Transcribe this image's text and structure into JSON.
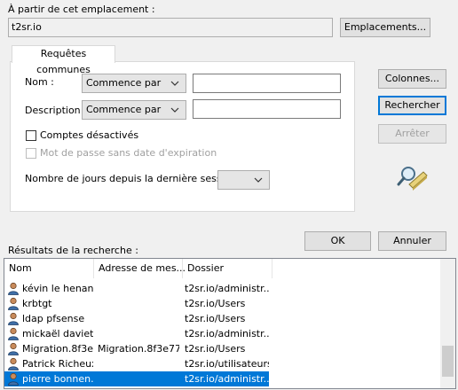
{
  "location": {
    "label": "À partir de cet emplacement :",
    "value": "t2sr.io",
    "button": "Emplacements..."
  },
  "tab": {
    "label": "Requêtes communes"
  },
  "query": {
    "name_label": "Nom :",
    "name_op": "Commence par",
    "name_value": "",
    "desc_label": "Description :",
    "desc_op": "Commence par",
    "desc_value": "",
    "disabled_accounts": "Comptes désactivés",
    "no_expire_pw": "Mot de passe sans date d'expiration",
    "days_label": "Nombre de jours depuis la dernière session :",
    "days_value": ""
  },
  "buttons": {
    "columns": "Colonnes...",
    "search": "Rechercher",
    "stop": "Arrêter",
    "ok": "OK",
    "cancel": "Annuler"
  },
  "results": {
    "label": "Résultats de la recherche :",
    "columns": [
      "Nom",
      "Adresse de mes...",
      "Dossier"
    ],
    "rows": [
      {
        "name": "kévin le henanf",
        "email": "",
        "folder": "t2sr.io/administr...",
        "selected": false
      },
      {
        "name": "krbtgt",
        "email": "",
        "folder": "t2sr.io/Users",
        "selected": false
      },
      {
        "name": "ldap pfsense",
        "email": "",
        "folder": "t2sr.io/Users",
        "selected": false
      },
      {
        "name": "mickaël daviet",
        "email": "",
        "folder": "t2sr.io/administr...",
        "selected": false
      },
      {
        "name": "Migration.8f3e...",
        "email": "Migration.8f3e77...",
        "folder": "t2sr.io/Users",
        "selected": false
      },
      {
        "name": "Patrick Richeux",
        "email": "",
        "folder": "t2sr.io/utilisateurs",
        "selected": false
      },
      {
        "name": "pierre bonnen...",
        "email": "",
        "folder": "t2sr.io/administr...",
        "selected": true
      }
    ]
  },
  "colors": {
    "selection": "#0078d7",
    "accent": "#0078d7"
  }
}
